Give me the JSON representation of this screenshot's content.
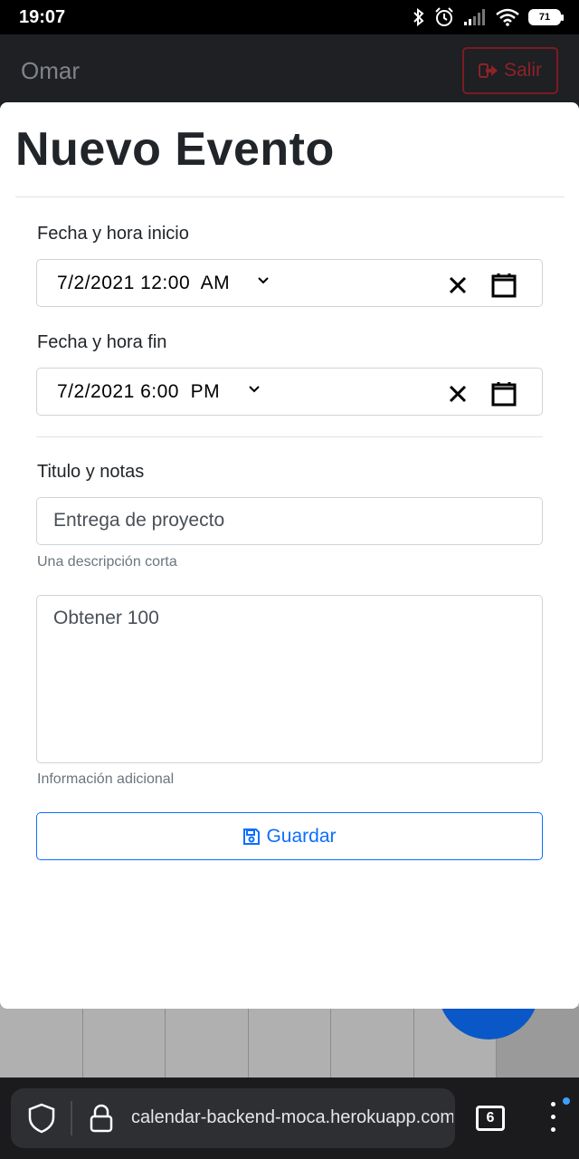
{
  "status_bar": {
    "time": "19:07",
    "battery": "71"
  },
  "navbar": {
    "user_name": "Omar",
    "logout_label": "Salir"
  },
  "modal": {
    "title": "Nuevo Evento",
    "start": {
      "label": "Fecha y hora inicio",
      "value": "7/2/2021 12:00  AM"
    },
    "end": {
      "label": "Fecha y hora fin",
      "value": "7/2/2021 6:00  PM"
    },
    "title_field": {
      "label": "Titulo y notas",
      "value": "Entrega de proyecto",
      "help": "Una descripción corta"
    },
    "notes": {
      "value": "Obtener 100",
      "help": "Información adicional"
    },
    "save_label": "Guardar"
  },
  "browser": {
    "url": "calendar-backend-moca.herokuapp.com",
    "tab_count": "6"
  },
  "colors": {
    "primary": "#0d6efd",
    "danger": "#8c2329",
    "navbar": "#1e2023",
    "fab": "#0a58c7"
  }
}
